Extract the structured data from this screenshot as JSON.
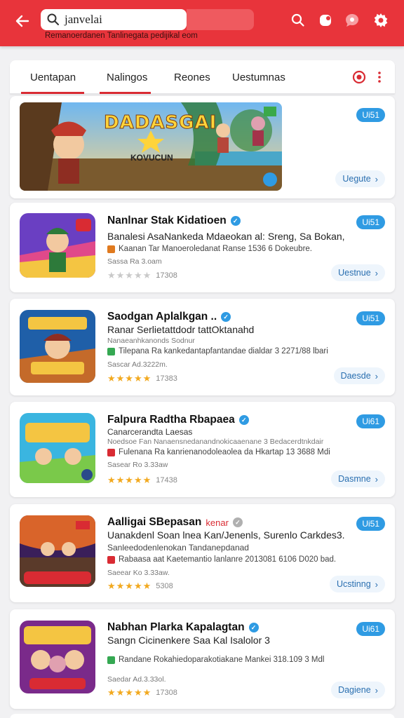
{
  "header": {
    "search_value": "janvelai",
    "subtitle": "Remanoerdanen Tanlinegata pedijikal eom",
    "back_icon": "arrow-left-icon",
    "icons": [
      "search-icon",
      "notification-icon",
      "chat-icon",
      "gear-icon"
    ],
    "accent": "#e8343b"
  },
  "tabs": [
    {
      "label": "Uentapan",
      "active": true
    },
    {
      "label": "Nalingos",
      "active": true
    },
    {
      "label": "Reones",
      "active": false
    },
    {
      "label": "Uestumnas",
      "active": false
    }
  ],
  "banner": {
    "title": "DADASGAI",
    "subtitle": "KOVUCUN",
    "pill": "Ui51",
    "action": "Uegute"
  },
  "apps": [
    {
      "title": "Nanlnar Stak Kidatioen",
      "verified": true,
      "desc": "Banalesi AsaNankeda Mdaeokan al: Sreng, Sa Bokan,",
      "meta": "Kaanan Tar Manoeroledanat Ranse 1536 6 Dokeubre.",
      "size": "Sassa Ra 3.oam",
      "rating": "17308",
      "pill": "Ui51",
      "action": "Uestnue",
      "meta_color": "#e07a1f"
    },
    {
      "title": "Saodgan Aplalkgan ..",
      "verified": true,
      "desc": "Ranar Serlietattdodr tattOktanahd",
      "meta": "Tilepana Ra kankedantapfantandae dialdar 3 2271/88 lbari",
      "size": "Sascar Ad.3222m.",
      "rating": "17383",
      "pill": "Ui51",
      "action": "Daesde",
      "meta_color": "#35a852",
      "sub_line": "Nanaeanhkanonds Sodnur"
    },
    {
      "title": "Falpura Radtha Rbapaea",
      "verified": true,
      "desc": "Canarcerandta Laesas",
      "meta": "Fulenana Ra kanrienanodoleaolea da Hkartap 13 3688 Mdi",
      "size": "Sasear Ro 3.33aw",
      "rating": "17438",
      "pill": "Ui61",
      "action": "Dasmne",
      "meta_color": "#d92b33",
      "sub_line": "Noedsoe Fan Nanaensnedanandnokicaaenane 3 Bedacerdtnkdair"
    },
    {
      "title": "Aalligai SBepasan",
      "tag": "kenar",
      "verified": false,
      "desc": "Uanakdenl Soan lnea Kan/Jenenls, Surenlo Carkdes3.",
      "meta": "Rabaasa aat Kaetemantio lanlanre 2013081 6106 D020 bad.",
      "size": "Saeear Ko 3.33aw.",
      "rating": "5308",
      "pill": "Ui51",
      "action": "Ucstinng",
      "meta_color": "#d92b33",
      "sub_line": "Sanleedodenlenokan Tandanepdanad"
    },
    {
      "title": "Nabhan Plarka Kapalagtan",
      "verified": true,
      "desc": "Sangn Cicinenkere Saa Kal Isalolor 3",
      "meta": "Randane Rokahiedoparakotiakane Mankei 318.109 3 Mdl",
      "size": "Saedar Ad.3.33ol.",
      "rating": "17308",
      "pill": "Ui61",
      "action": "Dagiene",
      "meta_color": "#35a852"
    }
  ]
}
